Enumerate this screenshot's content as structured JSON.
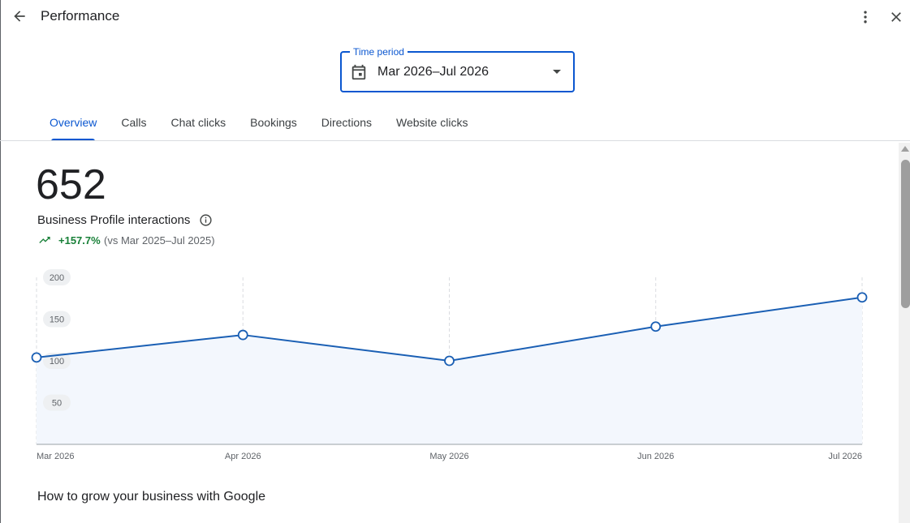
{
  "header": {
    "title": "Performance",
    "back_icon": "arrow-back-icon",
    "more_icon": "more-vert-icon",
    "close_icon": "close-icon"
  },
  "time_period": {
    "label": "Time period",
    "value": "Mar 2026–Jul 2026",
    "calendar_icon": "calendar-icon",
    "caret_icon": "arrow-drop-down-icon"
  },
  "tabs": [
    {
      "label": "Overview",
      "active": true
    },
    {
      "label": "Calls",
      "active": false
    },
    {
      "label": "Chat clicks",
      "active": false
    },
    {
      "label": "Bookings",
      "active": false
    },
    {
      "label": "Directions",
      "active": false
    },
    {
      "label": "Website clicks",
      "active": false
    }
  ],
  "summary": {
    "total": "652",
    "metric_label": "Business Profile interactions",
    "change": "+157.7%",
    "comparison": "(vs Mar 2025–Jul 2025)"
  },
  "colors": {
    "accent": "#0b57d0",
    "line": "#1a5fb4",
    "area": "#f3f7fd",
    "positive": "#188038"
  },
  "chart_data": {
    "type": "area",
    "categories": [
      "Mar 2026",
      "Apr 2026",
      "May 2026",
      "Jun 2026",
      "Jul 2026"
    ],
    "values": [
      104,
      131,
      100,
      141,
      176
    ],
    "y_ticks": [
      50,
      100,
      150,
      200
    ],
    "ylim": [
      0,
      200
    ],
    "grid": "vertical-dashed",
    "title": "",
    "xlabel": "",
    "ylabel": ""
  },
  "section": {
    "title": "How to grow your business with Google"
  }
}
